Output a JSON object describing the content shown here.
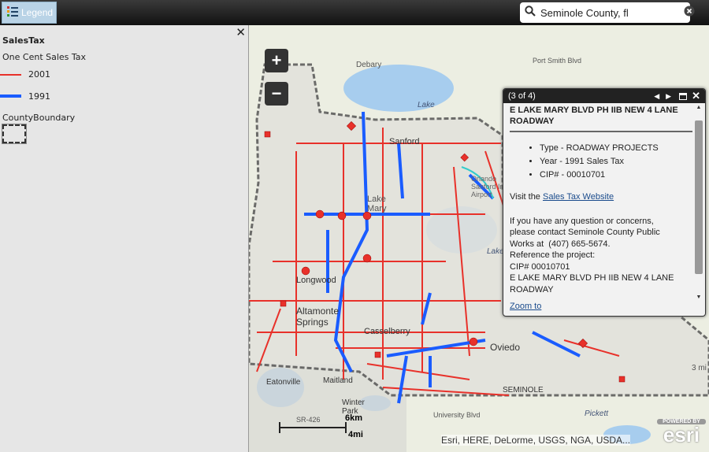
{
  "toolbar": {
    "legend_label": "Legend",
    "search_value": "Seminole County, fl"
  },
  "legend": {
    "layer_title": "SalesTax",
    "sublayer": "One Cent Sales Tax",
    "items": [
      {
        "label": "2001",
        "color": "#e8312a"
      },
      {
        "label": "1991",
        "color": "#1a5cff"
      }
    ],
    "boundary_label": "CountyBoundary"
  },
  "map": {
    "zoom_in": "+",
    "zoom_out": "−",
    "labels": [
      "Debary",
      "Lake",
      "Sanford",
      "Orlando Sanford Intl Airport",
      "Lake Mary",
      "Longwood",
      "Altamonte Springs",
      "Casselberry",
      "Oviedo",
      "Eatonville",
      "Maitland",
      "Winter Park",
      "SEMINOLE",
      "Pickett",
      "University Blvd",
      "SR-426",
      "Lake Jesup",
      "Port Smith Blvd",
      "3 mi"
    ],
    "scale_km": "6km",
    "scale_mi": "4mi",
    "attribution": "Esri, HERE, DeLorme, USGS, NGA, USDA...",
    "powered_by": "POWERED BY",
    "esri_logo": "esri"
  },
  "popup": {
    "counter": "(3 of 4)",
    "title": "E LAKE MARY BLVD PH IIB NEW 4 LANE ROADWAY",
    "bullets": [
      "Type - ROADWAY PROJECTS",
      "Year - 1991 Sales Tax",
      "CIP# - 00010701"
    ],
    "visit_prefix": "Visit the ",
    "link_text": "Sales Tax Website",
    "contact_lines": [
      "If you have any question or concerns,",
      "please contact Seminole County Public",
      "Works at  (407) 665-5674.",
      "Reference the project:",
      "CIP# 00010701",
      "E LAKE MARY BLVD PH IIB NEW 4 LANE ROADWAY"
    ],
    "zoom_to": "Zoom to"
  }
}
